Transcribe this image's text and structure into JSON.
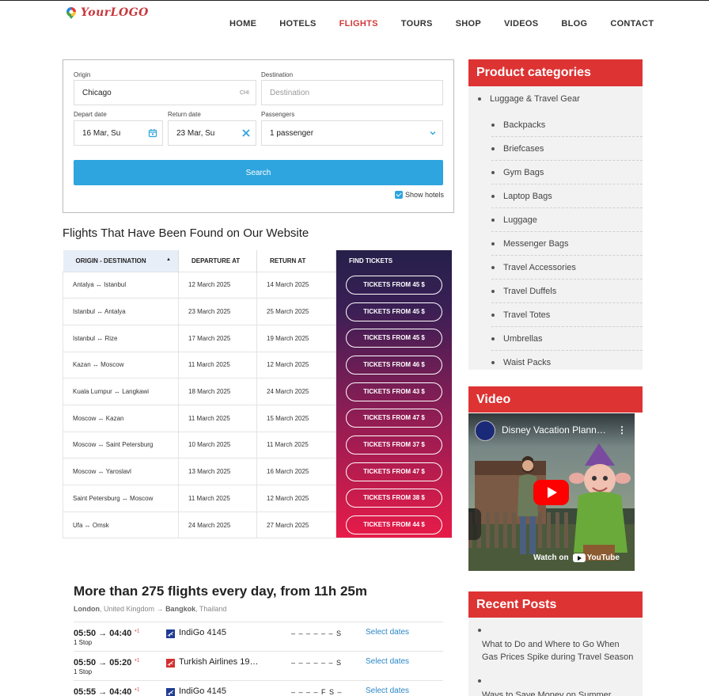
{
  "header": {
    "logo_text": "YourLOGO",
    "nav": [
      "HOME",
      "HOTELS",
      "FLIGHTS",
      "TOURS",
      "SHOP",
      "VIDEOS",
      "BLOG",
      "CONTACT"
    ],
    "active_nav": "FLIGHTS"
  },
  "search": {
    "origin_label": "Origin",
    "origin_value": "Chicago",
    "origin_code": "CHI",
    "destination_label": "Destination",
    "destination_placeholder": "Destination",
    "depart_label": "Depart date",
    "depart_value": "16 Mar, Su",
    "return_label": "Return date",
    "return_value": "23 Mar, Su",
    "passengers_label": "Passengers",
    "passengers_value": "1 passenger",
    "search_button": "Search",
    "show_hotels": "Show hotels"
  },
  "flights_section": {
    "title": "Flights That Have Been Found on Our Website",
    "headers": [
      "ORIGIN - DESTINATION",
      "DEPARTURE AT",
      "RETURN AT",
      "FIND TICKETS"
    ],
    "rows": [
      {
        "route": "Antalya ↔ Istanbul",
        "depart": "12 March 2025",
        "return": "14 March 2025",
        "ticket": "TICKETS FROM 45 $"
      },
      {
        "route": "Istanbul ↔ Antalya",
        "depart": "23 March 2025",
        "return": "25 March 2025",
        "ticket": "TICKETS FROM 45 $"
      },
      {
        "route": "Istanbul ↔ Rize",
        "depart": "17 March 2025",
        "return": "19 March 2025",
        "ticket": "TICKETS FROM 45 $"
      },
      {
        "route": "Kazan ↔ Moscow",
        "depart": "11 March 2025",
        "return": "12 March 2025",
        "ticket": "TICKETS FROM 46 $"
      },
      {
        "route": "Kuala Lumpur ↔ Langkawi",
        "depart": "18 March 2025",
        "return": "24 March 2025",
        "ticket": "TICKETS FROM 43 $"
      },
      {
        "route": "Moscow ↔ Kazan",
        "depart": "11 March 2025",
        "return": "15 March 2025",
        "ticket": "TICKETS FROM 47 $"
      },
      {
        "route": "Moscow ↔ Saint Petersburg",
        "depart": "10 March 2025",
        "return": "11 March 2025",
        "ticket": "TICKETS FROM 37 $"
      },
      {
        "route": "Moscow ↔ Yaroslavl",
        "depart": "13 March 2025",
        "return": "16 March 2025",
        "ticket": "TICKETS FROM 47 $"
      },
      {
        "route": "Saint Petersburg ↔ Moscow",
        "depart": "11 March 2025",
        "return": "12 March 2025",
        "ticket": "TICKETS FROM 38 $"
      },
      {
        "route": "Ufa ↔ Omsk",
        "depart": "24 March 2025",
        "return": "27 March 2025",
        "ticket": "TICKETS FROM 44 $"
      }
    ]
  },
  "more_flights": {
    "title": "More than 275 flights every day, from 11h 25m",
    "from_city": "London",
    "from_country": ", United Kingdom",
    "arrow": " → ",
    "to_city": "Bangkok",
    "to_country": ", Thailand",
    "rows": [
      {
        "time": "05:50 → 04:40",
        "plus": "+1",
        "stops": "1 Stop",
        "airline": "IndiGo 4145",
        "days": "– – – – – – S",
        "action": "Select dates",
        "icon_color": "#1f3a93"
      },
      {
        "time": "05:50 → 05:20",
        "plus": "+1",
        "stops": "1 Stop",
        "airline": "Turkish Airlines 19…",
        "days": "– – – – – – S",
        "action": "Select dates",
        "icon_color": "#d32f2f"
      },
      {
        "time": "05:55 → 04:40",
        "plus": "+1",
        "stops": "",
        "airline": "IndiGo 4145",
        "days": "– – – – F S –",
        "action": "Select dates",
        "icon_color": "#1f3a93"
      }
    ]
  },
  "sidebar": {
    "categories_title": "Product categories",
    "top_category": "Luggage & Travel Gear",
    "categories": [
      "Backpacks",
      "Briefcases",
      "Gym Bags",
      "Laptop Bags",
      "Luggage",
      "Messenger Bags",
      "Travel Accessories",
      "Travel Duffels",
      "Travel Totes",
      "Umbrellas",
      "Waist Packs"
    ],
    "video_title": "Video",
    "video": {
      "caption": "Disney Vacation Plann…",
      "watch_on": "Watch on",
      "youtube": "YouTube"
    },
    "recent_title": "Recent Posts",
    "posts": [
      "What to Do and Where to Go When Gas Prices Spike during Travel Season",
      "Ways to Save Money on Summer"
    ]
  },
  "colors": {
    "accent_red": "#dd3333",
    "search_blue": "#2ea5de",
    "link_blue": "#2a86c6"
  }
}
